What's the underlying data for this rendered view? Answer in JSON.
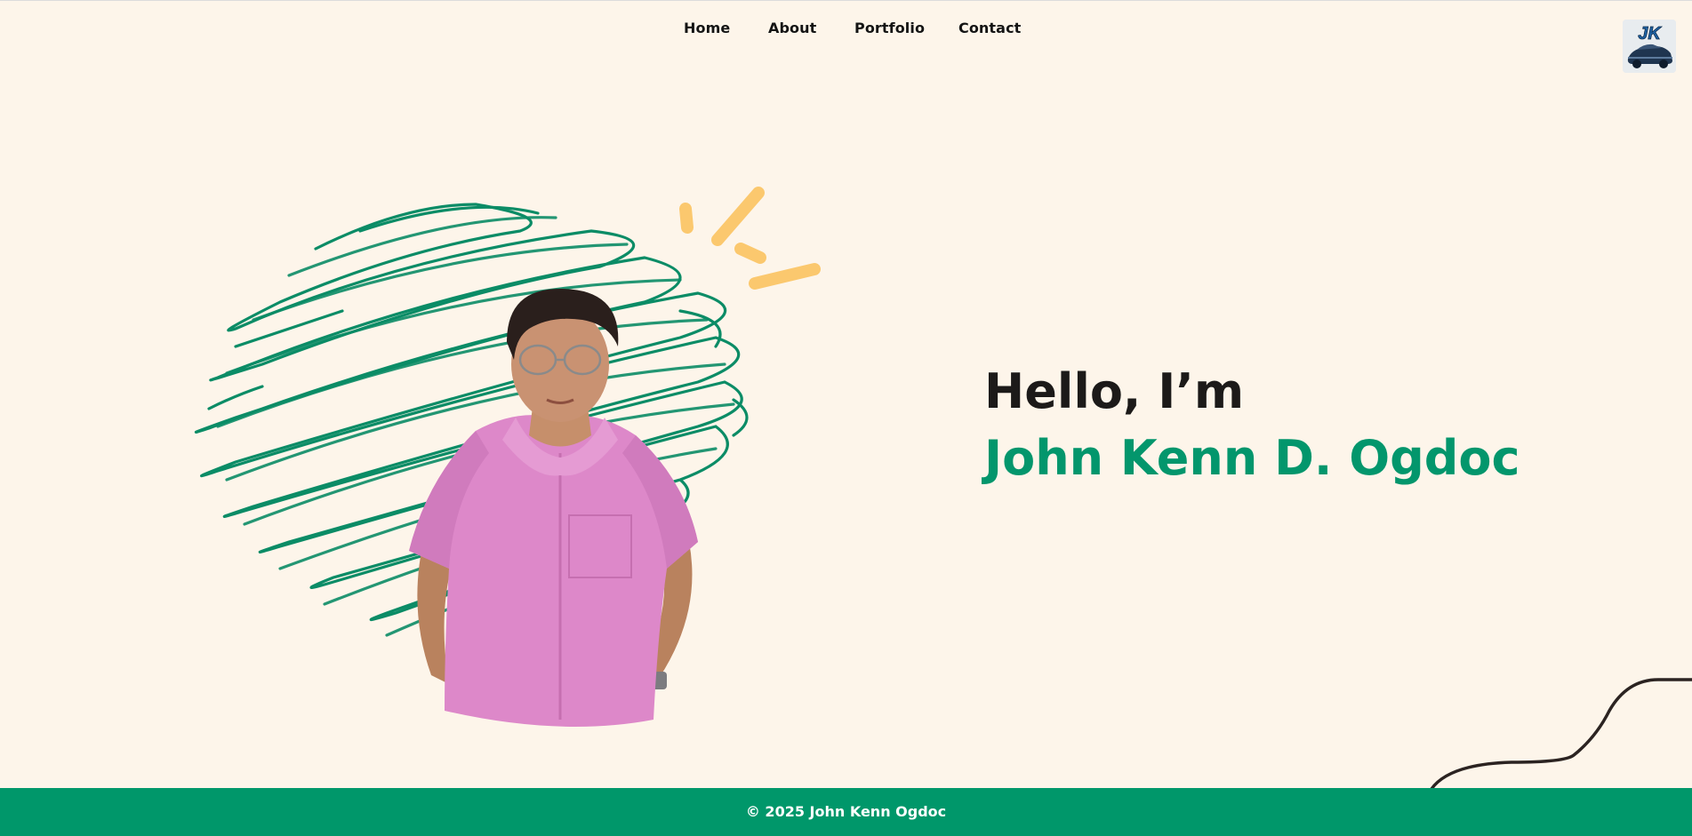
{
  "nav": {
    "items": [
      {
        "label": "Home"
      },
      {
        "label": "About"
      },
      {
        "label": "Portfolio"
      },
      {
        "label": "Contact"
      }
    ]
  },
  "logo": {
    "initials": "JK"
  },
  "hero": {
    "greeting": "Hello, I’m",
    "name": "John Kenn D. Ogdoc"
  },
  "footer": {
    "copyright": "© 2025 John Kenn Ogdoc"
  },
  "colors": {
    "background": "#fdf5ea",
    "accent_green": "#03966c",
    "ray_yellow": "#fbc86e",
    "text_dark": "#1c1a19",
    "footer_bg": "#00976a"
  },
  "icons": {
    "scribble": "green-scribble-background",
    "rays": "yellow-sparkle-rays",
    "squiggle": "dark-wavy-line"
  }
}
